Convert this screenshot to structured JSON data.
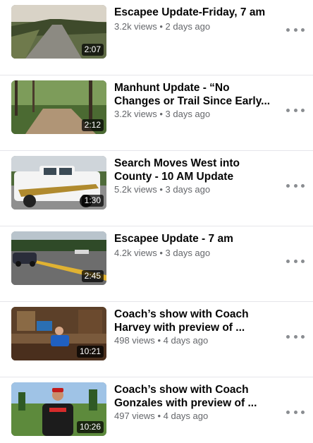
{
  "videos": [
    {
      "title": "Escapee Update-Friday, 7 am",
      "views": "3.2k views",
      "age": "2 days ago",
      "duration": "2:07"
    },
    {
      "title": "Manhunt Update - “No Changes or Trail Since Early...",
      "views": "3.2k views",
      "age": "3 days ago",
      "duration": "2:12"
    },
    {
      "title": "Search Moves West into County - 10 AM Update",
      "views": "5.2k views",
      "age": "3 days ago",
      "duration": "1:30"
    },
    {
      "title": "Escapee Update - 7 am",
      "views": "4.2k views",
      "age": "3 days ago",
      "duration": "2:45"
    },
    {
      "title": "Coach’s show with Coach Harvey with preview of ...",
      "views": "498 views",
      "age": "4 days ago",
      "duration": "10:21"
    },
    {
      "title": "Coach’s show with Coach Gonzales with preview of ...",
      "views": "497 views",
      "age": "4 days ago",
      "duration": "10:26"
    }
  ],
  "separator": "•",
  "icons": {
    "more": "more-horizontal-icon"
  }
}
